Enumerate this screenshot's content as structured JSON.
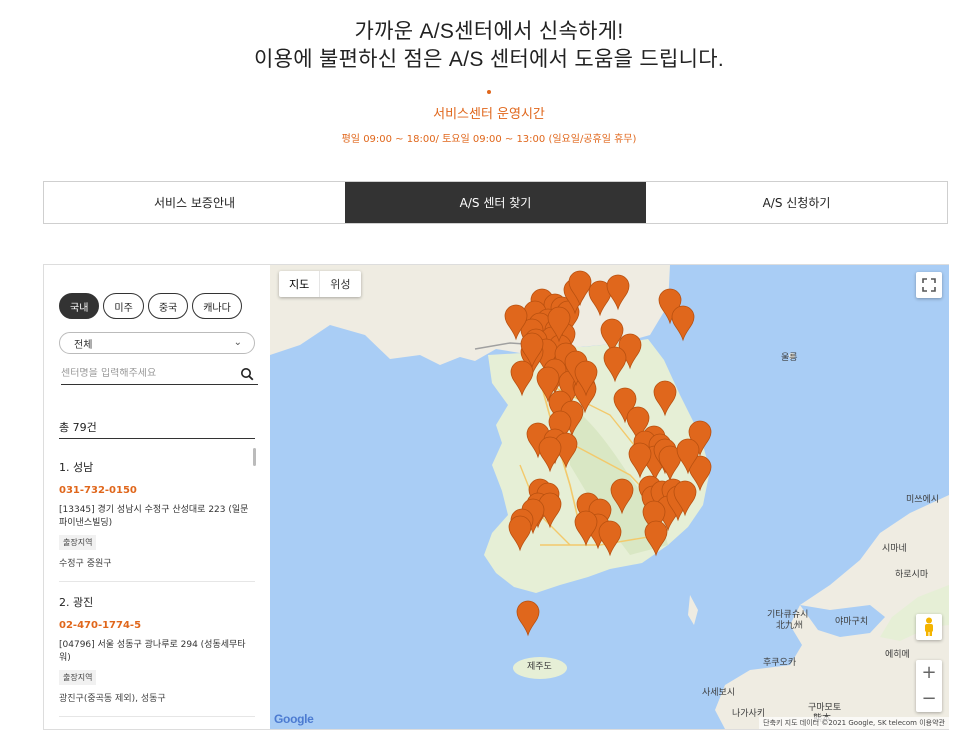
{
  "hero": {
    "line1": "가까운 A/S센터에서 신속하게!",
    "line2": "이용에 불편하신 점은 A/S 센터에서 도움을 드립니다.",
    "hours_title": "서비스센터 운영시간",
    "hours_text": "평일 09:00 ~ 18:00/ 토요일 09:00 ~ 13:00 (일요일/공휴일 휴무)"
  },
  "tabs": [
    {
      "label": "서비스 보증안내",
      "active": false
    },
    {
      "label": "A/S 센터 찾기",
      "active": true
    },
    {
      "label": "A/S 신청하기",
      "active": false
    }
  ],
  "sidebar": {
    "regions": [
      "국내",
      "미주",
      "중국",
      "캐나다"
    ],
    "select_value": "전체",
    "search_placeholder": "센터명을 입력해주세요",
    "count": "총 79건",
    "items": [
      {
        "name": "1. 성남",
        "phone": "031-732-0150",
        "address": "[13345] 경기 성남시 수정구 산성대로 223 (일문파이낸스빌딩)",
        "badge": "출장지역",
        "area": "수정구 중원구"
      },
      {
        "name": "2. 광진",
        "phone": "02-470-1774-5",
        "address": "[04796] 서울 성동구 광나루로 294 (성동세무타워)",
        "badge": "출장지역",
        "area": "광진구(중곡동 제외), 성동구"
      }
    ]
  },
  "map": {
    "toggle_map": "지도",
    "toggle_satellite": "위성",
    "logo": "Google",
    "attribution": "단축키  지도 데이터 ©2021 Google, SK telecom   이용약관",
    "labels": [
      {
        "text": "울릉",
        "kind": "land"
      },
      {
        "text": "제주도",
        "kind": "land"
      },
      {
        "text": "미쓰에시",
        "kind": "land"
      },
      {
        "text": "시마네",
        "kind": "land"
      },
      {
        "text": "하로시마",
        "kind": "land"
      },
      {
        "text": "기타큐슈시",
        "kind": "land"
      },
      {
        "text": "北九州",
        "kind": "land"
      },
      {
        "text": "야마구치",
        "kind": "land"
      },
      {
        "text": "후쿠오카",
        "kind": "land"
      },
      {
        "text": "구마모토",
        "kind": "land"
      },
      {
        "text": "熊本",
        "kind": "land"
      },
      {
        "text": "나가사키",
        "kind": "land"
      },
      {
        "text": "사세보시",
        "kind": "land"
      },
      {
        "text": "에히메",
        "kind": "land"
      }
    ],
    "pin_count": 79,
    "colors": {
      "pin": "#e0671c",
      "sea": "#a9cdf5",
      "land": "#f2efe6",
      "accent": "#e0671c"
    }
  }
}
